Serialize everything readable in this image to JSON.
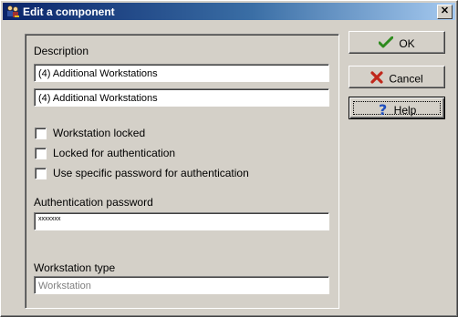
{
  "window": {
    "title": "Edit a component",
    "close_glyph": "✕",
    "icon": "users-key-icon"
  },
  "form": {
    "description_label": "Description",
    "description_1": "(4)  Additional Workstations",
    "description_2": "(4)  Additional Workstations",
    "checkboxes": [
      {
        "label": "Workstation locked",
        "checked": false
      },
      {
        "label": "Locked for authentication",
        "checked": false
      },
      {
        "label": "Use specific password for authentication",
        "checked": false
      }
    ],
    "auth_password_label": "Authentication password",
    "auth_password_value": "xxxxxxx",
    "workstation_type_label": "Workstation type",
    "workstation_type_value": "Workstation"
  },
  "buttons": {
    "ok": {
      "label": "OK",
      "icon": "checkmark-icon",
      "color": "#2e8b1e"
    },
    "cancel": {
      "label": "Cancel",
      "icon": "x-mark-icon",
      "color": "#c0281c"
    },
    "help": {
      "label": "Help",
      "icon": "question-mark-icon",
      "color": "#1f4fbf"
    }
  }
}
